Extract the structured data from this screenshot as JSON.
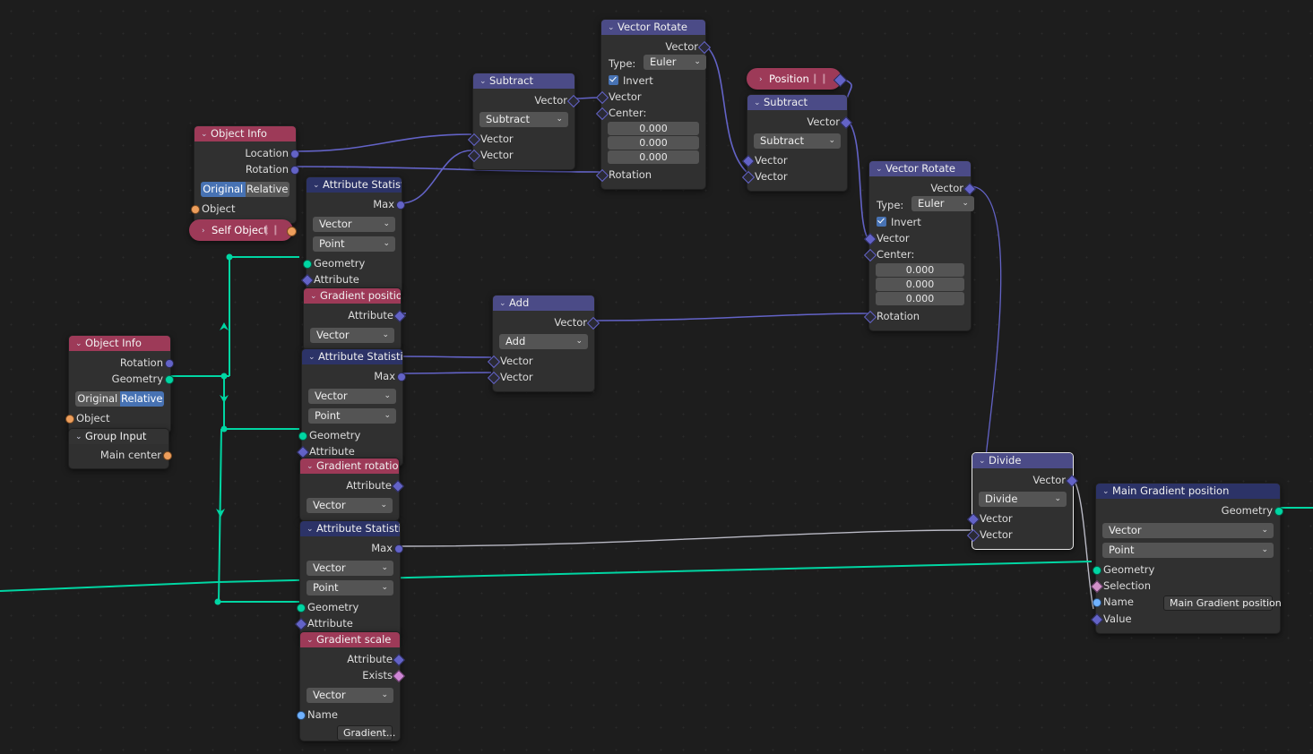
{
  "app": {
    "editor": "Blender Geometry Node Editor"
  },
  "colors": {
    "header_blue": "#4b4b87",
    "header_red": "#9d3a58",
    "header_navy": "#2c3367",
    "header_dark": "#333333",
    "node_body": "#303030",
    "background": "#1d1d1d",
    "link_vector": "#6363c7",
    "link_geometry": "#00d6a3",
    "link_grey": "#b9b9c4",
    "socket_vector": "#6363c7",
    "socket_geometry": "#00d6a3",
    "socket_object": "#ed9e5c",
    "socket_boolean": "#cf86d6",
    "socket_string": "#70b2ff",
    "selected_outline": "#e8e8e8"
  },
  "nodes": {
    "vector_rotate_1": {
      "title": "Vector Rotate",
      "out_vector": "Vector",
      "type_label": "Type:",
      "type_value": "Euler",
      "invert_label": "Invert",
      "in_vector": "Vector",
      "center_label": "Center:",
      "center": [
        "0.000",
        "0.000",
        "0.000"
      ],
      "in_rotation": "Rotation"
    },
    "vector_rotate_2": {
      "title": "Vector Rotate",
      "out_vector": "Vector",
      "type_label": "Type:",
      "type_value": "Euler",
      "invert_label": "Invert",
      "in_vector": "Vector",
      "center_label": "Center:",
      "center": [
        "0.000",
        "0.000",
        "0.000"
      ],
      "in_rotation": "Rotation"
    },
    "subtract_1": {
      "title": "Subtract",
      "out_vector": "Vector",
      "operation": "Subtract",
      "in_vector_a": "Vector",
      "in_vector_b": "Vector"
    },
    "subtract_2": {
      "title": "Subtract",
      "out_vector": "Vector",
      "operation": "Subtract",
      "in_vector_a": "Vector",
      "in_vector_b": "Vector"
    },
    "add": {
      "title": "Add",
      "out_vector": "Vector",
      "operation": "Add",
      "in_vector_a": "Vector",
      "in_vector_b": "Vector"
    },
    "divide": {
      "title": "Divide",
      "out_vector": "Vector",
      "operation": "Divide",
      "in_vector_a": "Vector",
      "in_vector_b": "Vector"
    },
    "position": {
      "title": "Position"
    },
    "self_object": {
      "title": "Self Object"
    },
    "object_info_1": {
      "title": "Object Info",
      "out_location": "Location",
      "out_rotation": "Rotation",
      "mode_original": "Original",
      "mode_relative": "Relative",
      "mode_selected": "Original",
      "in_object": "Object"
    },
    "object_info_2": {
      "title": "Object Info",
      "out_rotation": "Rotation",
      "out_geometry": "Geometry",
      "mode_original": "Original",
      "mode_relative": "Relative",
      "mode_selected": "Relative",
      "in_object": "Object"
    },
    "group_input": {
      "title": "Group Input",
      "out_main_center": "Main center"
    },
    "attribute_statistic_1": {
      "title": "Attribute Statistic",
      "out_max": "Max",
      "data_type": "Vector",
      "domain": "Point",
      "in_geometry": "Geometry",
      "in_attribute": "Attribute"
    },
    "attribute_statistic_2": {
      "title": "Attribute Statistic",
      "out_max": "Max",
      "data_type": "Vector",
      "domain": "Point",
      "in_geometry": "Geometry",
      "in_attribute": "Attribute"
    },
    "attribute_statistic_3": {
      "title": "Attribute Statistic",
      "out_max": "Max",
      "data_type": "Vector",
      "domain": "Point",
      "in_geometry": "Geometry",
      "in_attribute": "Attribute"
    },
    "gradient_position": {
      "title": "Gradient position",
      "out_attribute": "Attribute",
      "data_type": "Vector"
    },
    "gradient_rotation": {
      "title": "Gradient rotation",
      "out_attribute": "Attribute",
      "data_type": "Vector"
    },
    "gradient_scale": {
      "title": "Gradient scale",
      "out_attribute": "Attribute",
      "out_exists": "Exists",
      "data_type": "Vector",
      "name_label": "Name",
      "name_value": "Gradient..."
    },
    "main_gradient_position": {
      "title": "Main Gradient position",
      "out_geometry": "Geometry",
      "data_type": "Vector",
      "domain": "Point",
      "in_geometry": "Geometry",
      "in_selection": "Selection",
      "name_label": "Name",
      "name_value": "Main Gradient position",
      "in_value": "Value"
    }
  },
  "icons": {
    "collapse_chevron_down": "⌄",
    "collapse_chevron_right": "›",
    "dropdown_arrow": "⌄",
    "grip": "❙❙"
  }
}
